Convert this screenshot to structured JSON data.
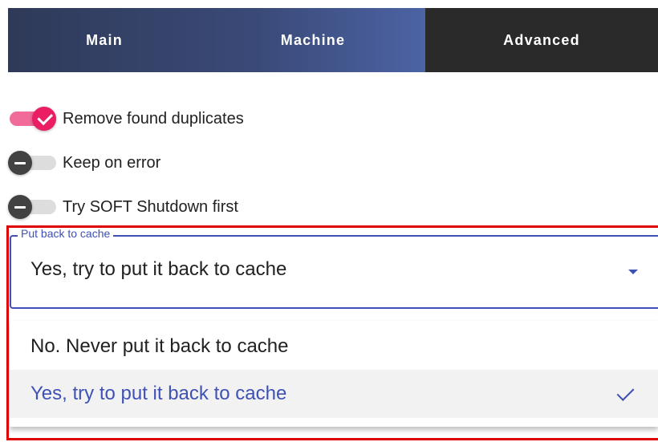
{
  "tabs": [
    {
      "label": "Main"
    },
    {
      "label": "Machine"
    },
    {
      "label": "Advanced",
      "active": true
    }
  ],
  "switches": [
    {
      "label": "Remove found duplicates",
      "checked": true
    },
    {
      "label": "Keep on error",
      "checked": false
    },
    {
      "label": "Try SOFT Shutdown first",
      "checked": false
    }
  ],
  "put_back": {
    "legend": "Put back to cache",
    "selected": "Yes, try to put it back to cache",
    "options": [
      {
        "label": "No. Never put it back to cache"
      },
      {
        "label": "Yes, try to put it back to cache",
        "selected": true
      }
    ]
  },
  "colors": {
    "accent": "#3f51b5",
    "switch_on": "#e91e63",
    "highlight": "#e00000"
  }
}
